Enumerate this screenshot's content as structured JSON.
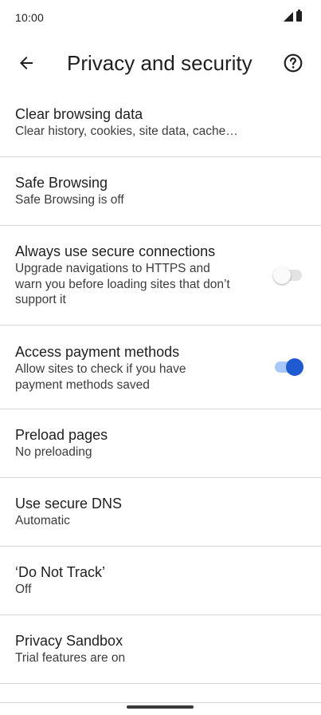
{
  "status_bar": {
    "time": "10:00",
    "icons": [
      "signal-icon",
      "battery-icon"
    ]
  },
  "app_bar": {
    "title": "Privacy and security",
    "back_icon": "arrow-back-icon",
    "help_icon": "help-icon"
  },
  "settings": [
    {
      "title": "Clear browsing data",
      "summary": [
        "Clear history, cookies, site data, cache…"
      ]
    },
    {
      "title": "Safe Browsing",
      "summary": [
        "Safe Browsing is off"
      ]
    },
    {
      "title": "Always use secure connections",
      "summary": [
        "Upgrade navigations to HTTPS and",
        "warn you before loading sites that don’t",
        "support it"
      ],
      "toggle": "off"
    },
    {
      "title": "Access payment methods",
      "summary": [
        "Allow sites to check if you have",
        "payment methods saved"
      ],
      "toggle": "on"
    },
    {
      "title": "Preload pages",
      "summary": [
        "No preloading"
      ]
    },
    {
      "title": "Use secure DNS",
      "summary": [
        "Automatic"
      ]
    },
    {
      "title": "‘Do Not Track’",
      "summary": [
        "Off"
      ]
    },
    {
      "title": "Privacy Sandbox",
      "summary": [
        "Trial features are on"
      ]
    }
  ],
  "colors": {
    "accent": "#1f5ad1",
    "toggle_on_track": "#a8c7fa",
    "divider": "#d6d6d6",
    "text_primary": "#1f1f1f",
    "text_secondary": "#3c3c3c"
  }
}
